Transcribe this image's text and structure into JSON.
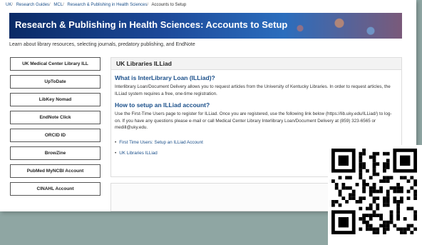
{
  "breadcrumb": [
    "UK",
    "Research Guides",
    "MCL",
    "Research & Publishing in Health Sciences",
    "Accounts to Setup"
  ],
  "banner": {
    "title": "Research & Publishing in Health Sciences: Accounts to Setup"
  },
  "subtitle": "Learn about library resources, selecting journals, predatory publishing, and EndNote",
  "sidebar": {
    "items": [
      "UK Medical Center Library ILL",
      "UpToDate",
      "LibKey Nomad",
      "EndNote Click",
      "ORCID ID",
      "BrowZine",
      "PubMed MyNCBI Account",
      "CINAHL Account"
    ]
  },
  "main": {
    "header": "UK Libraries ILLiad",
    "section1": {
      "heading": "What is InterLibrary Loan (ILLiad)?",
      "text": "Interlibrary Loan/Document Delivery allows you to request articles from the University of Kentucky Libraries. In order to request articles, the ILLiad system requires a free, one-time registration."
    },
    "section2": {
      "heading": "How to setup an ILLiad account?",
      "text": "Use the First-Time Users page to register for ILLiad. Once you are registered, use the following link below (https://lib.uky.edu/ILLiad/) to log-on. If you have any questions please e-mail or call Medical Center Library Interlibrary Loan/Document Delivery at (859) 323-6565 or medill@uky.edu."
    },
    "links": [
      "First Time Users: Setup an ILLiad Account",
      "UK Libraries ILLiad"
    ]
  },
  "colors": {
    "banner": "#1d4a9a",
    "link": "#1a4f8a",
    "background": "#8fa6a3"
  },
  "icons": {
    "qr": "qr-code-icon"
  }
}
